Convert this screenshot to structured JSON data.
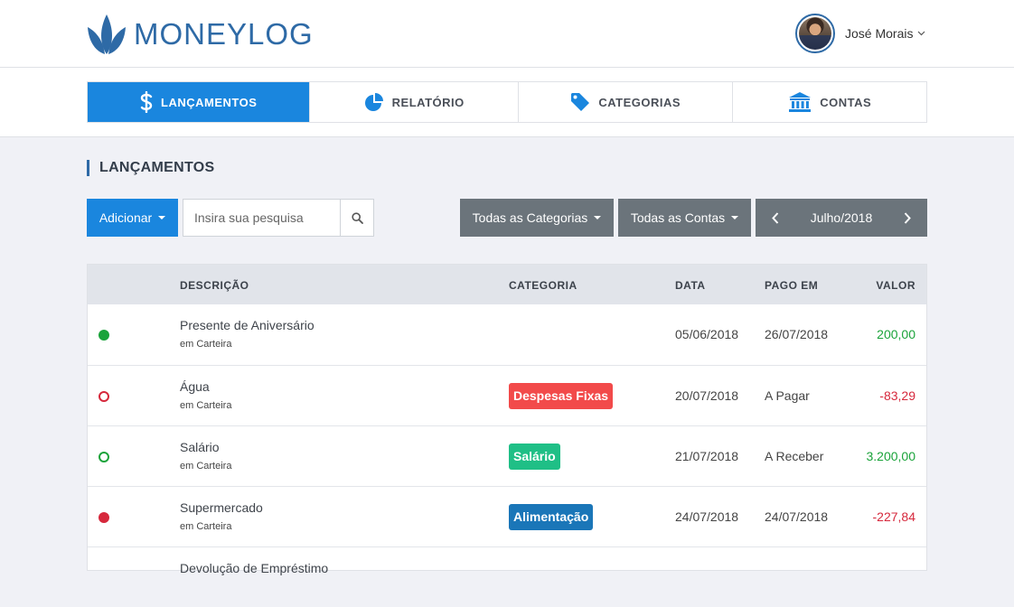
{
  "app": {
    "name": "MONEYLOG"
  },
  "user": {
    "name": "José Morais"
  },
  "nav": {
    "tabs": [
      {
        "label": "LANÇAMENTOS",
        "icon": "dollar-icon",
        "active": true
      },
      {
        "label": "RELATÓRIO",
        "icon": "pie-chart-icon",
        "active": false
      },
      {
        "label": "CATEGORIAS",
        "icon": "tag-icon",
        "active": false
      },
      {
        "label": "CONTAS",
        "icon": "bank-icon",
        "active": false
      }
    ]
  },
  "page": {
    "title": "LANÇAMENTOS"
  },
  "toolbar": {
    "add_label": "Adicionar",
    "search_placeholder": "Insira sua pesquisa",
    "categories_label": "Todas as Categorias",
    "accounts_label": "Todas as Contas",
    "month_label": "Julho/2018"
  },
  "table": {
    "headers": {
      "description": "DESCRIÇÃO",
      "category": "CATEGORIA",
      "date": "DATA",
      "paid": "PAGO EM",
      "value": "VALOR"
    },
    "rows": [
      {
        "status": "paid-income",
        "title": "Presente de Aniversário",
        "account": "em Carteira",
        "category": "",
        "date": "05/06/2018",
        "paid": "26/07/2018",
        "value": "200,00"
      },
      {
        "status": "pending-expense",
        "title": "Água",
        "account": "em Carteira",
        "category": "Despesas Fixas",
        "date": "20/07/2018",
        "paid": "A Pagar",
        "value": "-83,29"
      },
      {
        "status": "pending-income",
        "title": "Salário",
        "account": "em Carteira",
        "category": "Salário",
        "date": "21/07/2018",
        "paid": "A Receber",
        "value": "3.200,00"
      },
      {
        "status": "paid-expense",
        "title": "Supermercado",
        "account": "em Carteira",
        "category": "Alimentação",
        "date": "24/07/2018",
        "paid": "24/07/2018",
        "value": "-227,84"
      },
      {
        "status": "",
        "title": "Devolução de Empréstimo",
        "account": "",
        "category": "",
        "date": "",
        "paid": "",
        "value": ""
      }
    ]
  },
  "colors": {
    "brand": "#2e6aa6",
    "primary": "#1a86de",
    "income": "#1aa33a",
    "expense": "#d6283c",
    "badge_fixed": "#f24a4a",
    "badge_salary": "#1fbf86",
    "badge_food": "#1a76b8"
  }
}
